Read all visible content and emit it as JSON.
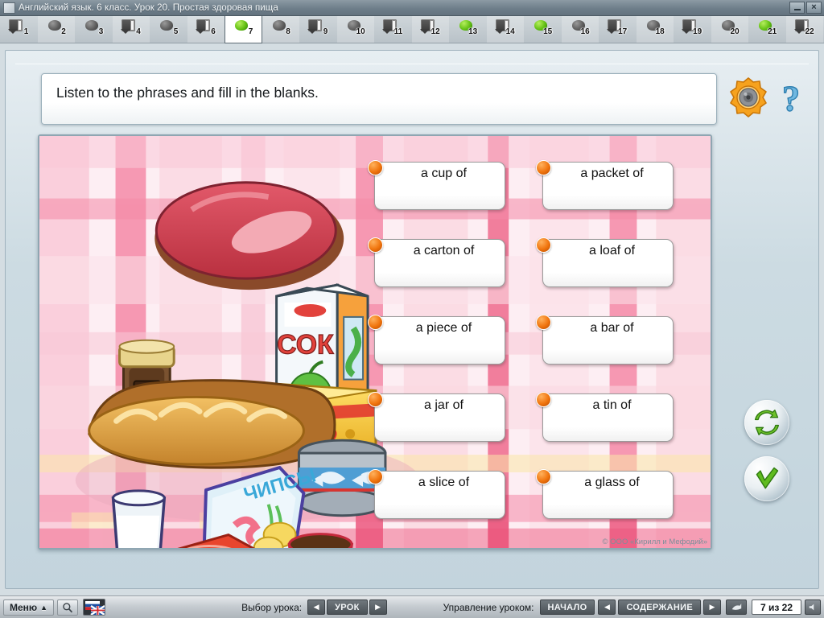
{
  "window": {
    "title": "Английский язык. 6 класс. Урок 20. Простая здоровая пища",
    "minimize_label": "−",
    "close_label": "×"
  },
  "tabstrip": {
    "items": [
      {
        "n": "1",
        "type": "film",
        "state": "normal"
      },
      {
        "n": "2",
        "type": "ball",
        "state": "normal"
      },
      {
        "n": "3",
        "type": "ball",
        "state": "normal"
      },
      {
        "n": "4",
        "type": "film",
        "state": "normal"
      },
      {
        "n": "5",
        "type": "ball",
        "state": "normal"
      },
      {
        "n": "6",
        "type": "film",
        "state": "normal"
      },
      {
        "n": "7",
        "type": "ball",
        "state": "current"
      },
      {
        "n": "8",
        "type": "ball",
        "state": "normal"
      },
      {
        "n": "9",
        "type": "film",
        "state": "normal"
      },
      {
        "n": "10",
        "type": "ball",
        "state": "normal"
      },
      {
        "n": "11",
        "type": "film",
        "state": "normal"
      },
      {
        "n": "12",
        "type": "film",
        "state": "normal"
      },
      {
        "n": "13",
        "type": "ball",
        "state": "done"
      },
      {
        "n": "14",
        "type": "film",
        "state": "normal"
      },
      {
        "n": "15",
        "type": "ball",
        "state": "done"
      },
      {
        "n": "16",
        "type": "ball",
        "state": "normal"
      },
      {
        "n": "17",
        "type": "film",
        "state": "normal"
      },
      {
        "n": "18",
        "type": "ball",
        "state": "normal"
      },
      {
        "n": "19",
        "type": "film",
        "state": "normal"
      },
      {
        "n": "20",
        "type": "ball",
        "state": "normal"
      },
      {
        "n": "21",
        "type": "ball",
        "state": "done"
      },
      {
        "n": "22",
        "type": "film",
        "state": "normal"
      }
    ]
  },
  "prompt": {
    "text": "Listen to the phrases and fill in the blanks."
  },
  "exercise": {
    "cards": [
      {
        "label": "a cup of",
        "col": "left",
        "row": 1
      },
      {
        "label": "a packet of",
        "col": "right",
        "row": 1
      },
      {
        "label": "a carton of",
        "col": "left",
        "row": 2
      },
      {
        "label": "a loaf of",
        "col": "right",
        "row": 2
      },
      {
        "label": "a piece of",
        "col": "left",
        "row": 3
      },
      {
        "label": "a bar of",
        "col": "right",
        "row": 3
      },
      {
        "label": "a jar of",
        "col": "left",
        "row": 4
      },
      {
        "label": "a tin of",
        "col": "right",
        "row": 4
      },
      {
        "label": "a slice of",
        "col": "left",
        "row": 5
      },
      {
        "label": "a glass of",
        "col": "right",
        "row": 5
      }
    ],
    "illustration_items": [
      "ham",
      "coffee-jar",
      "juice-carton-sok",
      "cheese-syr",
      "bread-loaf-basket",
      "tin-can-fish",
      "chips-packet-chipsy",
      "milk-glass",
      "chocolate-bar-box",
      "teacup-with-sugar"
    ],
    "copyright": "© ООО «Кирилл и Мефодий»"
  },
  "actions": {
    "reset_label": "reset",
    "check_label": "check"
  },
  "statusbar": {
    "menu_label": "Меню",
    "menu_caret": "▲",
    "lesson_select_label": "Выбор урока:",
    "lesson_prev": "◀",
    "lesson_button": "УРОК",
    "lesson_next": "▶",
    "lesson_control_label": "Управление уроком:",
    "start_button": "НАЧАЛО",
    "contents_prev": "◀",
    "contents_button": "СОДЕРЖАНИЕ",
    "contents_next": "▶",
    "page_indicator": "7 из 22"
  },
  "colors": {
    "accent_orange": "#f0740d",
    "green": "#63c014",
    "titlebar": "#6e7e8a",
    "cloth_pink": "#f48ba6",
    "cloth_light": "#fde7ee"
  }
}
